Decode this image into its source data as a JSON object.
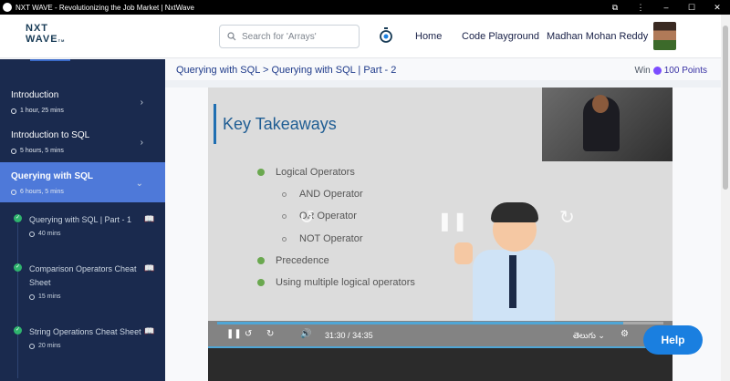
{
  "window": {
    "title": "NXT WAVE - Revolutionizing the Job Market | NxtWave"
  },
  "header": {
    "logo_top": "NXT",
    "logo_bottom": "WAVE",
    "logo_tm": "TM",
    "search_placeholder": "Search for 'Arrays'",
    "nav_home": "Home",
    "nav_code": "Code Playground",
    "user_name": "Madhan Mohan Reddy"
  },
  "sidebar": {
    "modules": [
      {
        "name": "Introduction",
        "duration": "1 hour, 25 mins"
      },
      {
        "name": "Introduction to SQL",
        "duration": "5 hours, 5 mins"
      },
      {
        "name": "Querying with SQL",
        "duration": "6 hours, 5 mins"
      }
    ],
    "topics": [
      {
        "name": "Querying with SQL | Part - 1",
        "duration": "40 mins"
      },
      {
        "name": "Comparison Operators Cheat Sheet",
        "duration": "15 mins"
      },
      {
        "name": "String Operations Cheat Sheet",
        "duration": "20 mins"
      }
    ]
  },
  "main": {
    "breadcrumb": "Querying with SQL > Querying with SQL | Part - 2",
    "win_label": "Win",
    "points": "100 Points"
  },
  "slide": {
    "heading": "Key Takeaways",
    "bullets": [
      "Logical Operators",
      "AND Operator",
      "OR Operator",
      "NOT Operator",
      "Precedence",
      "Using multiple logical operators"
    ]
  },
  "player": {
    "current_time": "31:30",
    "separator": "/",
    "total_time": "34:35",
    "language": "తెలుగు",
    "progress_fraction": 0.91,
    "skip_back": "10",
    "skip_forward": "10"
  },
  "help": {
    "label": "Help"
  },
  "colors": {
    "sidebar_bg": "#1a2a4e",
    "active_module": "#4e79d9",
    "accent": "#1a7fe0",
    "check": "#2fb46e"
  }
}
